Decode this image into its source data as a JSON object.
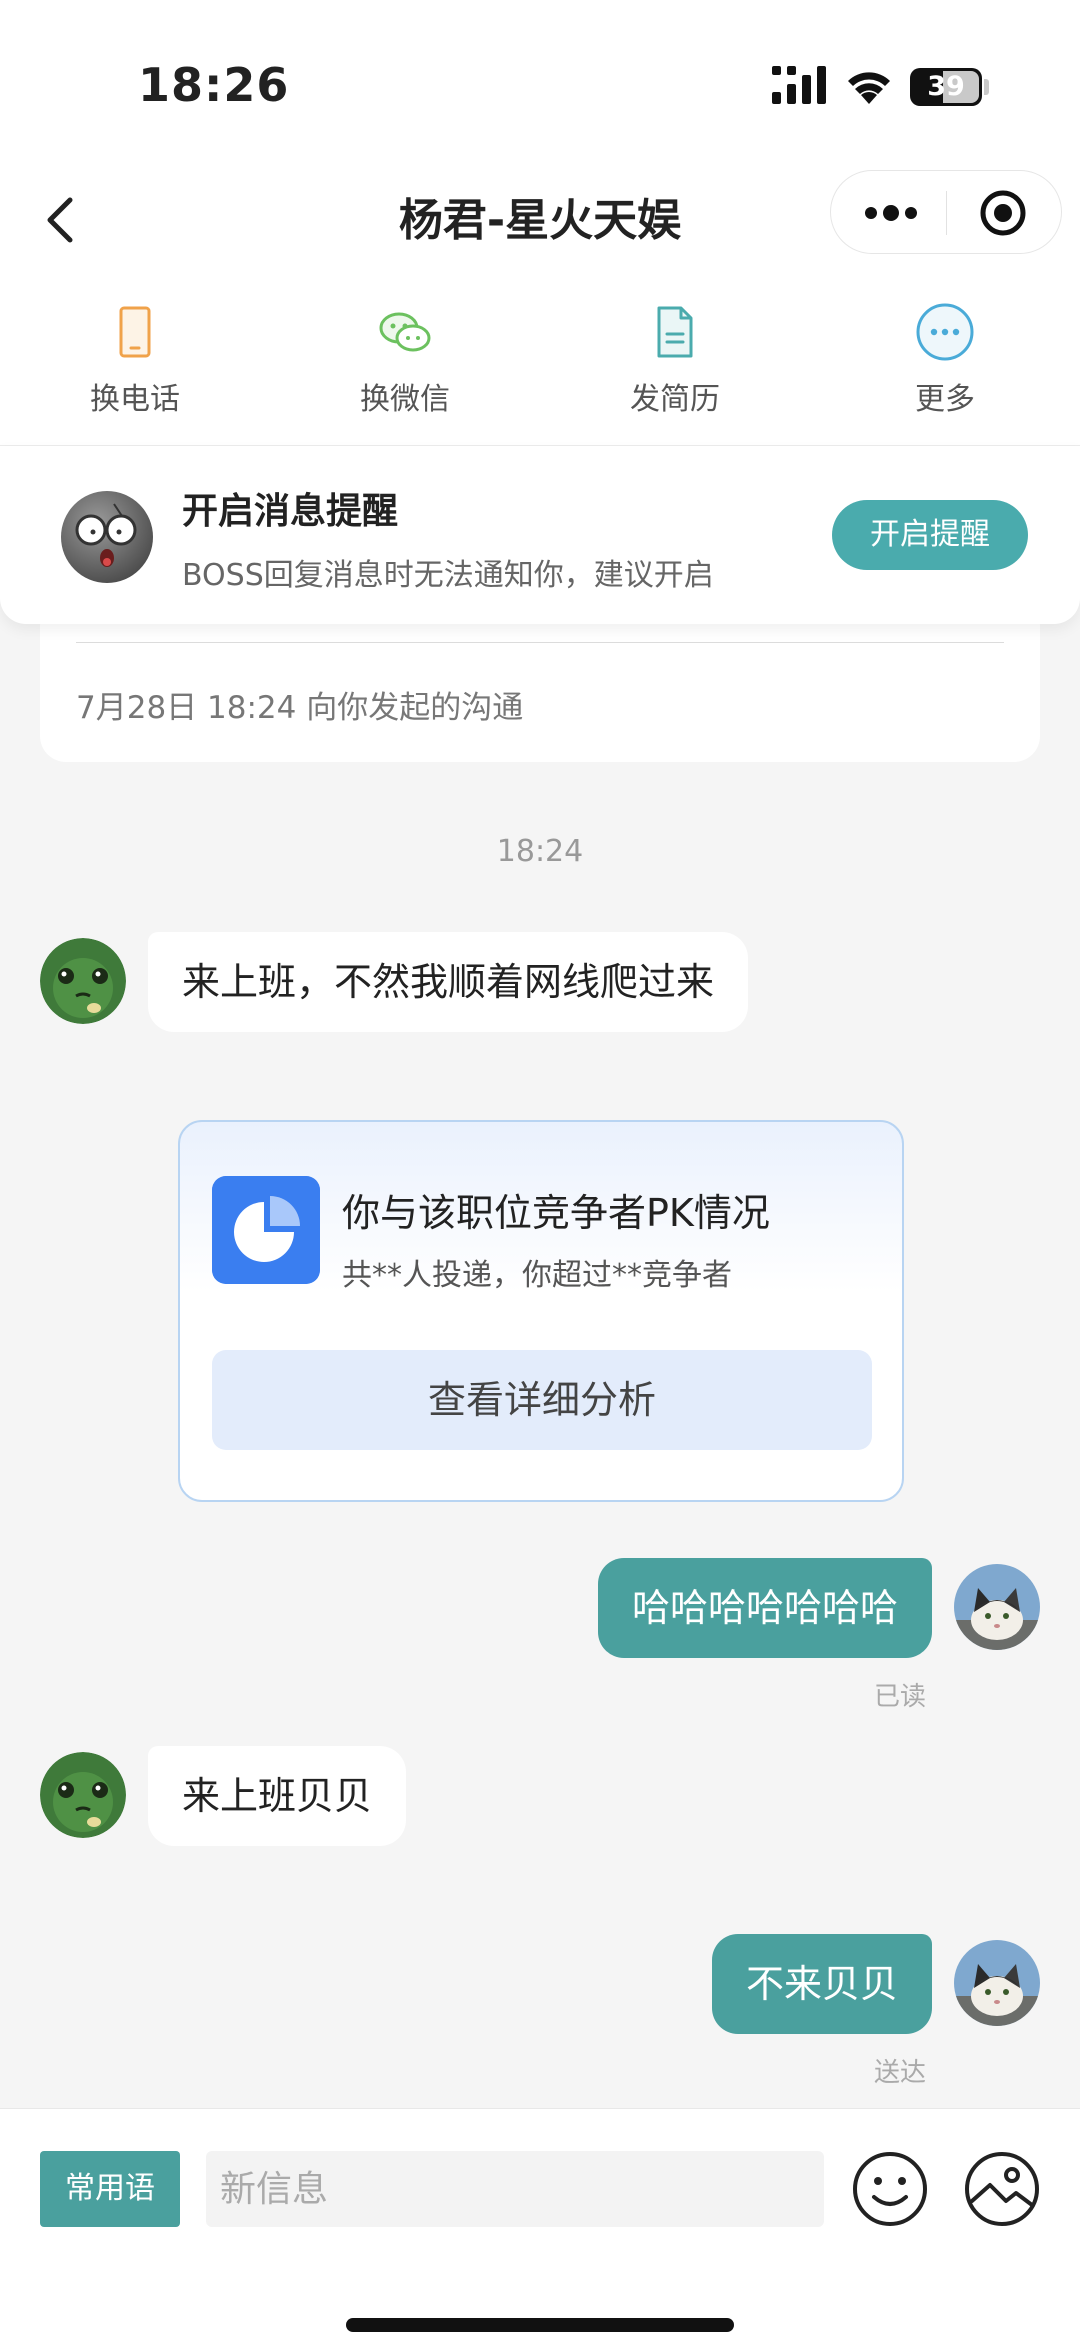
{
  "status_bar": {
    "time": "18:26",
    "battery": "39"
  },
  "nav": {
    "title": "杨君-星火天娱"
  },
  "actions": [
    {
      "label": "换电话",
      "icon": "phone-icon",
      "color": "#f0a24a"
    },
    {
      "label": "换微信",
      "icon": "wechat-icon",
      "color": "#6cc15f"
    },
    {
      "label": "发简历",
      "icon": "resume-icon",
      "color": "#4aabad"
    },
    {
      "label": "更多",
      "icon": "more-icon",
      "color": "#4aabd8"
    }
  ],
  "notify": {
    "title": "开启消息提醒",
    "subtitle": "BOSS回复消息时无法通知你，建议开启",
    "button": "开启提醒"
  },
  "top_card": {
    "text": "7月28日 18:24 向你发起的沟通"
  },
  "chat": {
    "timestamp": "18:24",
    "messages": [
      {
        "from": "boss",
        "text": "来上班，不然我顺着网线爬过来"
      },
      {
        "from": "me",
        "text": "哈哈哈哈哈哈哈",
        "status": "已读"
      },
      {
        "from": "boss",
        "text": "来上班贝贝"
      },
      {
        "from": "me",
        "text": "不来贝贝",
        "status": "送达"
      }
    ]
  },
  "pk_card": {
    "title": "你与该职位竞争者PK情况",
    "subtitle": "共**人投递，你超过**竞争者",
    "button": "查看详细分析"
  },
  "input_bar": {
    "quick_label": "常用语",
    "placeholder": "新信息"
  },
  "colors": {
    "accent": "#4aa09e",
    "pk_blue": "#3a7ef0"
  }
}
